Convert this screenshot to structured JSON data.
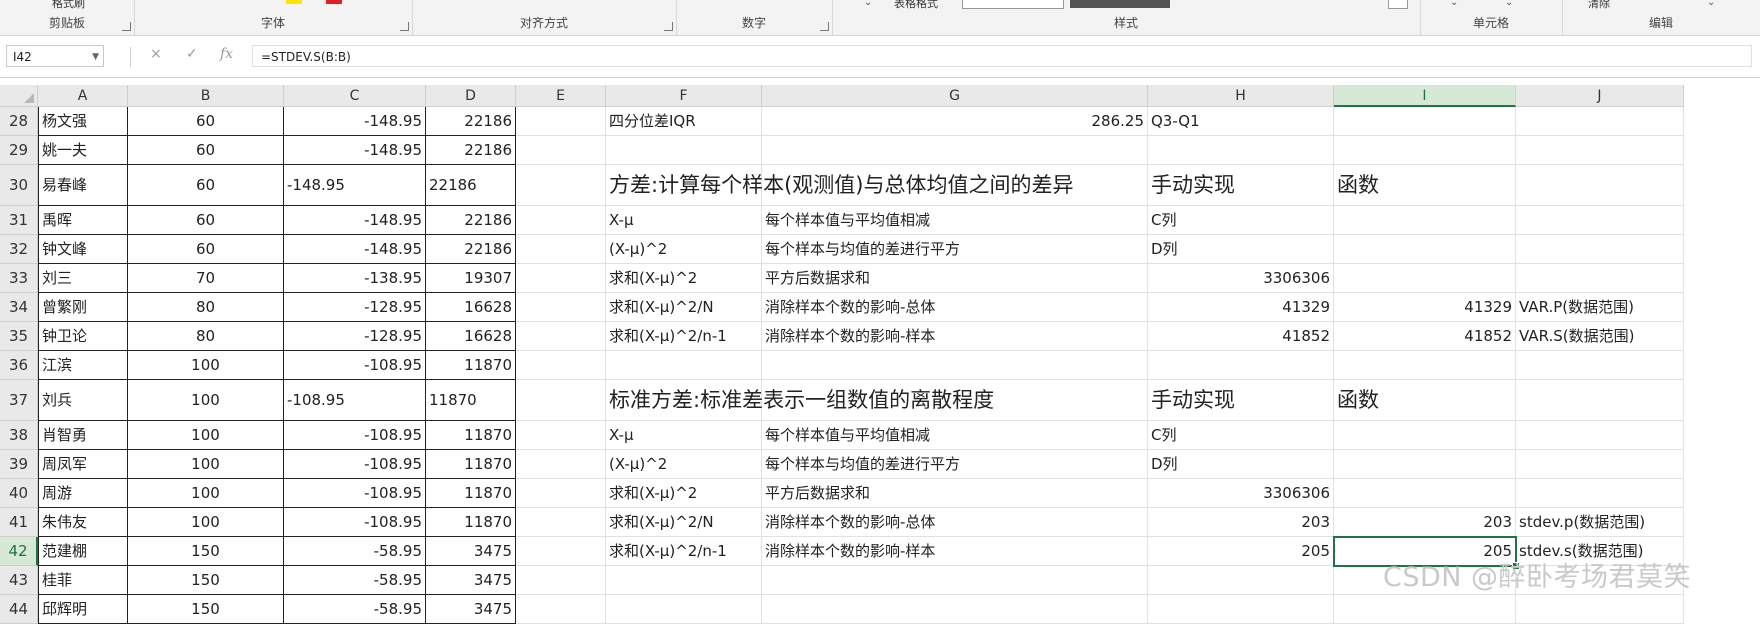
{
  "ribbon": {
    "snippets": {
      "format_painter": "格式刷",
      "table_format": "表格格式",
      "clear": "清除"
    },
    "groups": [
      {
        "id": "clipboard",
        "label": "剪贴板"
      },
      {
        "id": "font",
        "label": "字体"
      },
      {
        "id": "alignment",
        "label": "对齐方式"
      },
      {
        "id": "number",
        "label": "数字"
      },
      {
        "id": "styles",
        "label": "样式"
      },
      {
        "id": "cells",
        "label": "单元格"
      },
      {
        "id": "editing",
        "label": "编辑"
      }
    ],
    "colors": {
      "font_yellow": "#ffe600",
      "font_red": "#e02020"
    }
  },
  "formula_bar": {
    "name_box": "I42",
    "cancel_icon": "×",
    "enter_icon": "✓",
    "fx_icon": "fx",
    "formula": "=STDEV.S(B:B)"
  },
  "columns": [
    "A",
    "B",
    "C",
    "D",
    "E",
    "F",
    "G",
    "H",
    "I",
    "J"
  ],
  "selected_cell": {
    "column": "I",
    "row": 42
  },
  "rows": [
    {
      "n": "28",
      "A": "杨文强",
      "B": "60",
      "C": "-148.95",
      "D": "22186",
      "F": "四分位差IQR",
      "G": "286.25",
      "H": "Q3-Q1",
      "I": "",
      "J": ""
    },
    {
      "n": "29",
      "A": "姚一夫",
      "B": "60",
      "C": "-148.95",
      "D": "22186",
      "F": "",
      "G": "",
      "H": "",
      "I": "",
      "J": ""
    },
    {
      "n": "30",
      "A": "易春峰",
      "B": "60",
      "C": "-148.95",
      "D": "22186",
      "F": "方差:计算每个样本(观测值)与总体均值之间的差异",
      "G": "",
      "H": "手动实现",
      "I": "函数",
      "J": ""
    },
    {
      "n": "31",
      "A": "禹晖",
      "B": "60",
      "C": "-148.95",
      "D": "22186",
      "F": "X-μ",
      "G": "每个样本值与平均值相减",
      "H": "C列",
      "I": "",
      "J": ""
    },
    {
      "n": "32",
      "A": "钟文峰",
      "B": "60",
      "C": "-148.95",
      "D": "22186",
      "F": "(X-μ)^2",
      "G": "每个样本与均值的差进行平方",
      "H": "D列",
      "I": "",
      "J": ""
    },
    {
      "n": "33",
      "A": "刘三",
      "B": "70",
      "C": "-138.95",
      "D": "19307",
      "F": "求和(X-μ)^2",
      "G": "平方后数据求和",
      "H": "3306306",
      "I": "",
      "J": ""
    },
    {
      "n": "34",
      "A": "曾繁刚",
      "B": "80",
      "C": "-128.95",
      "D": "16628",
      "F": "求和(X-μ)^2/N",
      "G": "消除样本个数的影响-总体",
      "H": "41329",
      "I": "41329",
      "J": "VAR.P(数据范围)"
    },
    {
      "n": "35",
      "A": "钟卫论",
      "B": "80",
      "C": "-128.95",
      "D": "16628",
      "F": "求和(X-μ)^2/n-1",
      "G": "消除样本个数的影响-样本",
      "H": "41852",
      "I": "41852",
      "J": "VAR.S(数据范围)"
    },
    {
      "n": "36",
      "A": "江滨",
      "B": "100",
      "C": "-108.95",
      "D": "11870",
      "F": "",
      "G": "",
      "H": "",
      "I": "",
      "J": ""
    },
    {
      "n": "37",
      "A": "刘兵",
      "B": "100",
      "C": "-108.95",
      "D": "11870",
      "F": "标准方差:标准差表示一组数值的离散程度",
      "G": "",
      "H": "手动实现",
      "I": "函数",
      "J": ""
    },
    {
      "n": "38",
      "A": "肖智勇",
      "B": "100",
      "C": "-108.95",
      "D": "11870",
      "F": "X-μ",
      "G": "每个样本值与平均值相减",
      "H": "C列",
      "I": "",
      "J": ""
    },
    {
      "n": "39",
      "A": "周凤军",
      "B": "100",
      "C": "-108.95",
      "D": "11870",
      "F": "(X-μ)^2",
      "G": "每个样本与均值的差进行平方",
      "H": "D列",
      "I": "",
      "J": ""
    },
    {
      "n": "40",
      "A": "周游",
      "B": "100",
      "C": "-108.95",
      "D": "11870",
      "F": "求和(X-μ)^2",
      "G": "平方后数据求和",
      "H": "3306306",
      "I": "",
      "J": ""
    },
    {
      "n": "41",
      "A": "朱伟友",
      "B": "100",
      "C": "-108.95",
      "D": "11870",
      "F": "求和(X-μ)^2/N",
      "G": "消除样本个数的影响-总体",
      "H": "203",
      "I": "203",
      "J": "stdev.p(数据范围)"
    },
    {
      "n": "42",
      "A": "范建棚",
      "B": "150",
      "C": "-58.95",
      "D": "3475",
      "F": "求和(X-μ)^2/n-1",
      "G": "消除样本个数的影响-样本",
      "H": "205",
      "I": "205",
      "J": "stdev.s(数据范围)"
    },
    {
      "n": "43",
      "A": "桂菲",
      "B": "150",
      "C": "-58.95",
      "D": "3475",
      "F": "",
      "G": "",
      "H": "",
      "I": "",
      "J": ""
    },
    {
      "n": "44",
      "A": "邱辉明",
      "B": "150",
      "C": "-58.95",
      "D": "3475",
      "F": "",
      "G": "",
      "H": "",
      "I": "",
      "J": ""
    }
  ],
  "watermark": "CSDN @醉卧考场君莫笑"
}
